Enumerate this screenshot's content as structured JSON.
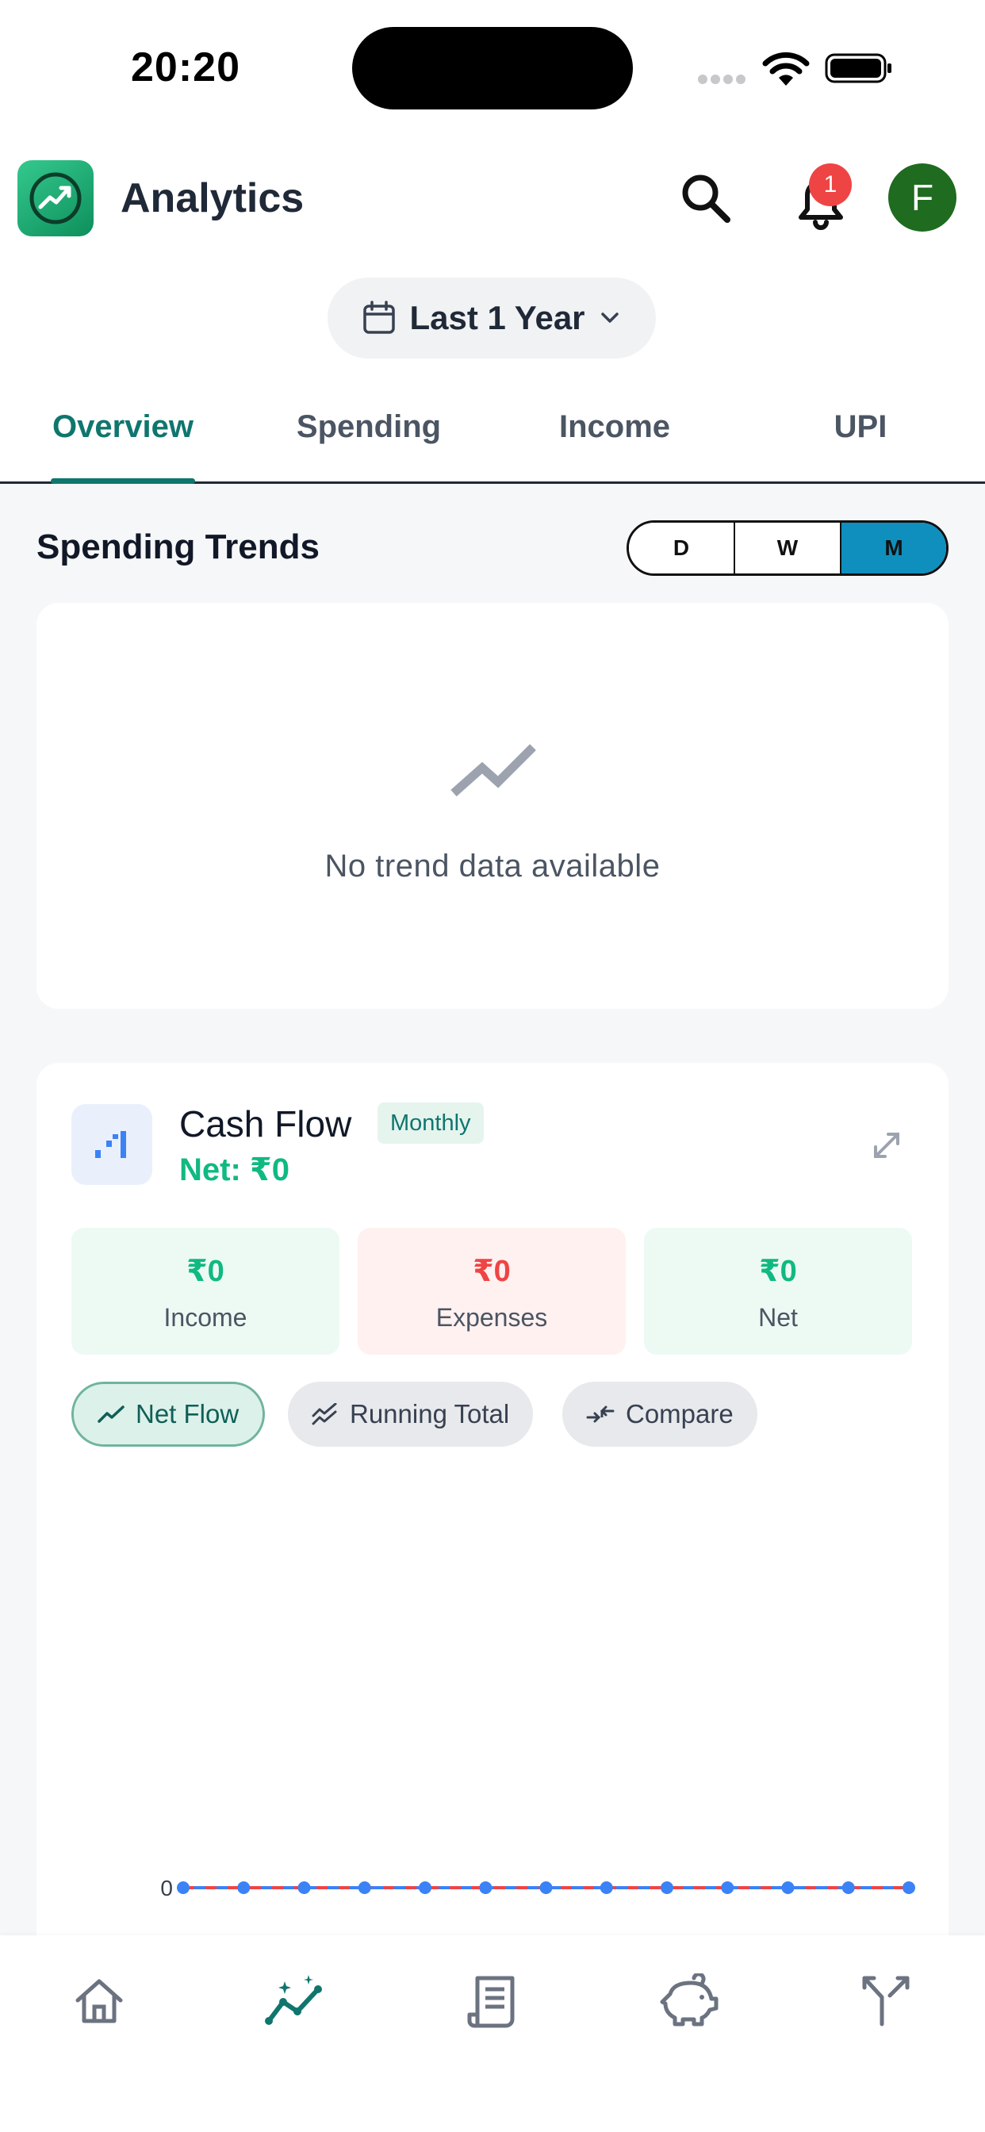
{
  "status_bar": {
    "time": "20:20"
  },
  "header": {
    "title": "Analytics",
    "notification_count": "1",
    "avatar_initial": "F"
  },
  "date_range": {
    "label": "Last 1 Year"
  },
  "tabs": [
    {
      "label": "Overview",
      "active": true
    },
    {
      "label": "Spending",
      "active": false
    },
    {
      "label": "Income",
      "active": false
    },
    {
      "label": "UPI",
      "active": false
    }
  ],
  "spending_trends": {
    "title": "Spending Trends",
    "period_options": [
      "D",
      "W",
      "M"
    ],
    "selected_period": "M",
    "empty_message": "No trend data available"
  },
  "cash_flow": {
    "title": "Cash Flow",
    "period_badge": "Monthly",
    "net_label": "Net: ₹0",
    "stats": [
      {
        "value": "₹0",
        "label": "Income"
      },
      {
        "value": "₹0",
        "label": "Expenses"
      },
      {
        "value": "₹0",
        "label": "Net"
      }
    ],
    "view_modes": [
      {
        "label": "Net Flow",
        "active": true
      },
      {
        "label": "Running Total",
        "active": false
      },
      {
        "label": "Compare",
        "active": false
      }
    ]
  },
  "chart_data": {
    "type": "line",
    "title": "",
    "xlabel": "",
    "ylabel": "",
    "y_tick_labels": [
      "0"
    ],
    "series": [
      {
        "values": [
          0,
          0,
          0,
          0,
          0,
          0,
          0,
          0,
          0,
          0,
          0,
          0,
          0
        ]
      },
      {
        "values": [
          0,
          0,
          0,
          0,
          0,
          0,
          0,
          0,
          0,
          0,
          0,
          0,
          0
        ]
      }
    ],
    "colors": {
      "series_a": "#3b82f6",
      "series_b": "#ef4444"
    }
  },
  "bottom_nav": [
    {
      "icon": "home-icon"
    },
    {
      "icon": "analytics-icon",
      "active": true
    },
    {
      "icon": "receipt-icon"
    },
    {
      "icon": "piggy-bank-icon"
    },
    {
      "icon": "split-icon"
    }
  ],
  "colors": {
    "accent": "#0f766e",
    "income": "#10b981",
    "expense": "#ef4444",
    "segment_active": "#0e8fbd"
  }
}
